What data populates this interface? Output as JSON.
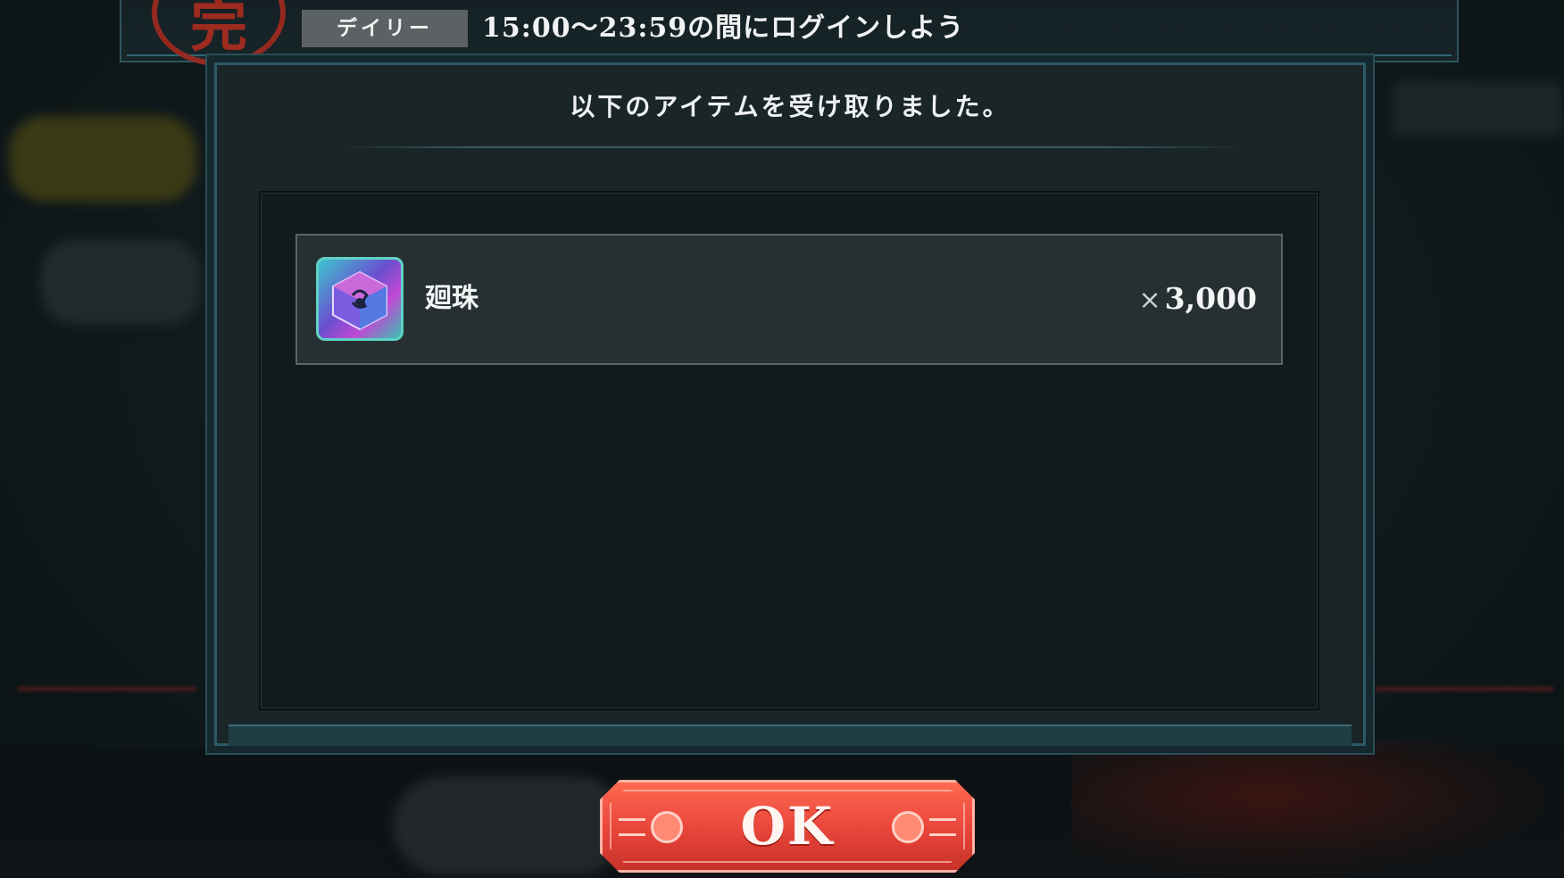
{
  "mission": {
    "tag": "デイリー",
    "text": "15:00～23:59の間にログインしよう"
  },
  "dialog": {
    "title": "以下のアイテムを受け取りました。"
  },
  "rewards": [
    {
      "name": "廻珠",
      "quantity_prefix": "×",
      "quantity": "3,000",
      "icon": "crystal-cube-icon"
    }
  ],
  "ok_button": {
    "label": "OK"
  },
  "colors": {
    "accent_red": "#e8443a",
    "frame_teal": "#2c5a66",
    "stamp_red": "#9b2a1f"
  }
}
